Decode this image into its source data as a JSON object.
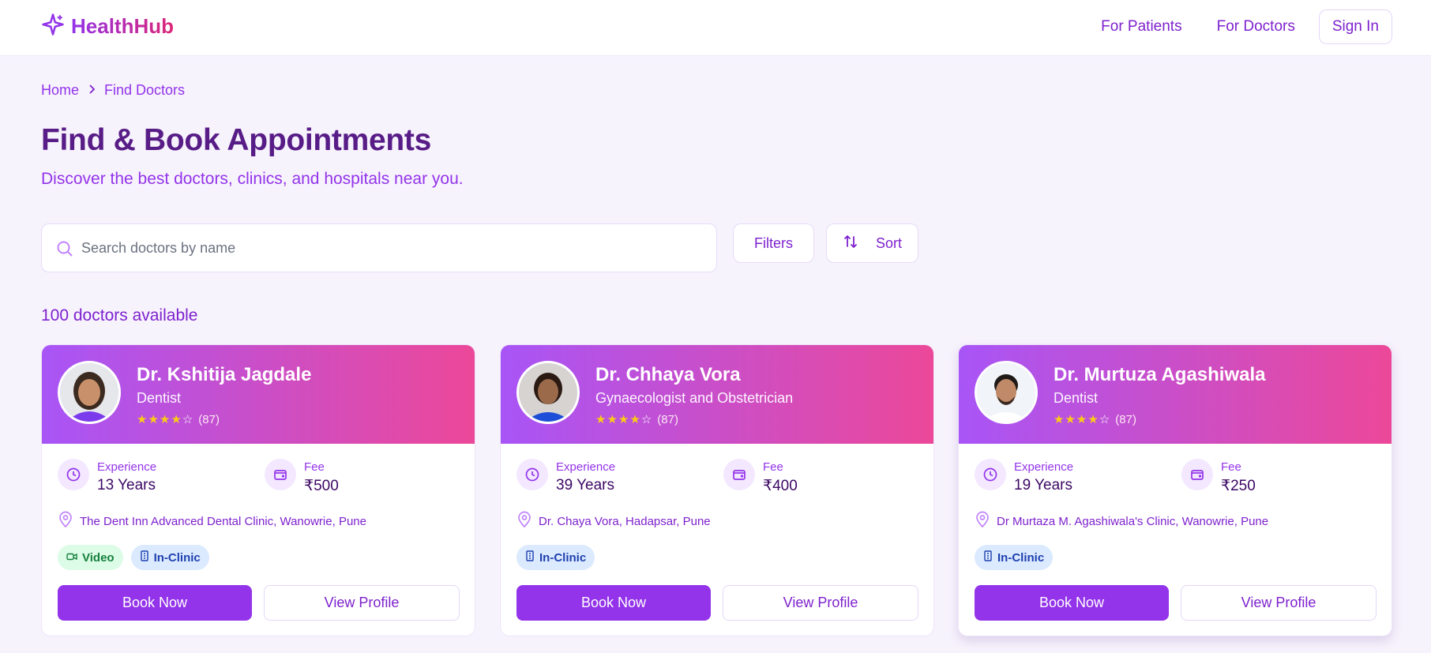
{
  "header": {
    "brand": "HealthHub",
    "nav": [
      "For Patients",
      "For Doctors"
    ],
    "sign_in": "Sign In"
  },
  "breadcrumb": [
    "Home",
    "Find Doctors"
  ],
  "page": {
    "title": "Find & Book Appointments",
    "subtitle": "Discover the best doctors, clinics, and hospitals near you."
  },
  "search": {
    "placeholder": "Search doctors by name",
    "value": ""
  },
  "toolbar": {
    "filters": "Filters",
    "sort": "Sort"
  },
  "results_count": "100 doctors available",
  "labels": {
    "experience": "Experience",
    "fee": "Fee",
    "book": "Book Now",
    "profile": "View Profile",
    "video": "Video",
    "in_clinic": "In-Clinic"
  },
  "doctors": [
    {
      "name": "Dr. Kshitija Jagdale",
      "specialty": "Dentist",
      "rating_stars": 4,
      "reviews": "(87)",
      "experience": "13 Years",
      "fee": "₹500",
      "location": "The Dent Inn Advanced Dental Clinic, Wanowrie, Pune",
      "modes": [
        "video",
        "in_clinic"
      ]
    },
    {
      "name": "Dr. Chhaya Vora",
      "specialty": "Gynaecologist and Obstetrician",
      "rating_stars": 4,
      "reviews": "(87)",
      "experience": "39 Years",
      "fee": "₹400",
      "location": "Dr. Chaya Vora, Hadapsar, Pune",
      "modes": [
        "in_clinic"
      ]
    },
    {
      "name": "Dr. Murtuza Agashiwala",
      "specialty": "Dentist",
      "rating_stars": 4,
      "reviews": "(87)",
      "experience": "19 Years",
      "fee": "₹250",
      "location": "Dr Murtaza M. Agashiwala's Clinic, Wanowrie, Pune",
      "modes": [
        "in_clinic"
      ]
    }
  ],
  "colors": {
    "primary": "#9333ea",
    "heading": "#581c87",
    "gradient_start": "#a855f7",
    "gradient_end": "#ec4899",
    "star": "#facc15",
    "video_bg": "#dcfce7",
    "clinic_bg": "#dbeafe"
  }
}
